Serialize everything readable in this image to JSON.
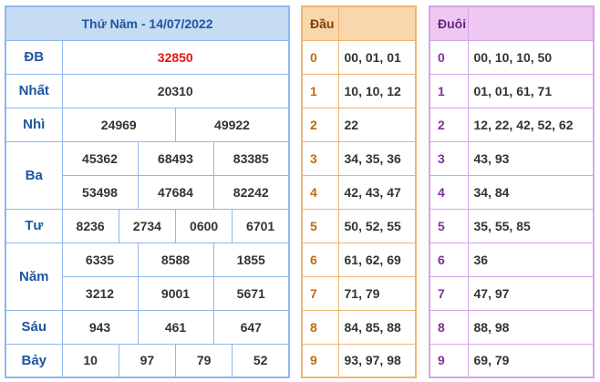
{
  "results": {
    "title": "Thứ Năm - 14/07/2022",
    "rows": [
      {
        "label": "ĐB",
        "values": [
          "32850"
        ]
      },
      {
        "label": "Nhất",
        "values": [
          "20310"
        ]
      },
      {
        "label": "Nhì",
        "values": [
          "24969",
          "49922"
        ]
      },
      {
        "label": "Ba",
        "values": [
          "45362",
          "68493",
          "83385",
          "53498",
          "47684",
          "82242"
        ]
      },
      {
        "label": "Tư",
        "values": [
          "8236",
          "2734",
          "0600",
          "6701"
        ]
      },
      {
        "label": "Năm",
        "values": [
          "6335",
          "8588",
          "1855",
          "3212",
          "9001",
          "5671"
        ]
      },
      {
        "label": "Sáu",
        "values": [
          "943",
          "461",
          "647"
        ]
      },
      {
        "label": "Bảy",
        "values": [
          "10",
          "97",
          "79",
          "52"
        ]
      }
    ],
    "colors": {
      "header_bg": "#c6dcf3",
      "border": "#90b8ec",
      "label": "#1f56a0",
      "special": "#e81414"
    }
  },
  "dau": {
    "header": "Đầu",
    "rows": [
      {
        "digit": "0",
        "values": "00, 01, 01"
      },
      {
        "digit": "1",
        "values": "10, 10, 12"
      },
      {
        "digit": "2",
        "values": "22"
      },
      {
        "digit": "3",
        "values": "34, 35, 36"
      },
      {
        "digit": "4",
        "values": "42, 43, 47"
      },
      {
        "digit": "5",
        "values": "50, 52, 55"
      },
      {
        "digit": "6",
        "values": "61, 62, 69"
      },
      {
        "digit": "7",
        "values": "71, 79"
      },
      {
        "digit": "8",
        "values": "84, 85, 88"
      },
      {
        "digit": "9",
        "values": "93, 97, 98"
      }
    ],
    "colors": {
      "header_bg": "#fad6ad",
      "border": "#f0b573",
      "digit": "#c06a0c"
    }
  },
  "duoi": {
    "header": "Đuôi",
    "rows": [
      {
        "digit": "0",
        "values": "00, 10, 10, 50"
      },
      {
        "digit": "1",
        "values": "01, 01, 61, 71"
      },
      {
        "digit": "2",
        "values": "12, 22, 42, 52, 62"
      },
      {
        "digit": "3",
        "values": "43, 93"
      },
      {
        "digit": "4",
        "values": "34, 84"
      },
      {
        "digit": "5",
        "values": "35, 55, 85"
      },
      {
        "digit": "6",
        "values": "36"
      },
      {
        "digit": "7",
        "values": "47, 97"
      },
      {
        "digit": "8",
        "values": "88, 98"
      },
      {
        "digit": "9",
        "values": "69, 79"
      }
    ],
    "colors": {
      "header_bg": "#eec7f3",
      "border": "#d4a6e6",
      "digit": "#82309c"
    }
  }
}
